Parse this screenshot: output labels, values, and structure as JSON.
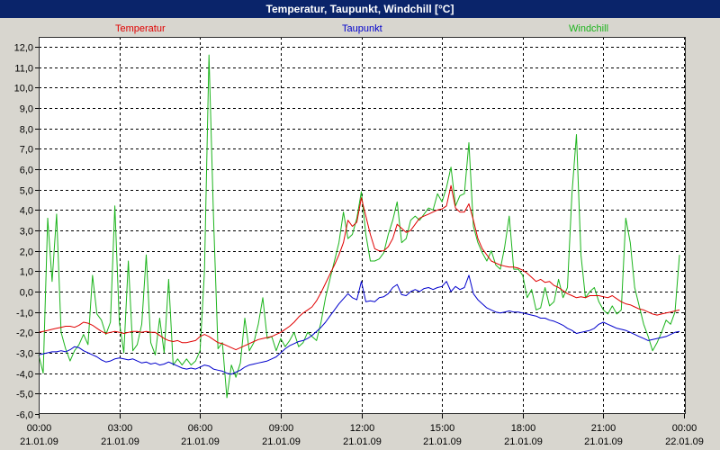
{
  "chart_data": {
    "type": "line",
    "title": "Temperatur, Taupunkt, Windchill [°C]",
    "x_axis": {
      "xlim": [
        "21.01.09 00:00",
        "22.01.09 00:00"
      ],
      "ticks": [
        {
          "time": "00:00",
          "date": "21.01.09"
        },
        {
          "time": "03:00",
          "date": "21.01.09"
        },
        {
          "time": "06:00",
          "date": "21.01.09"
        },
        {
          "time": "09:00",
          "date": "21.01.09"
        },
        {
          "time": "12:00",
          "date": "21.01.09"
        },
        {
          "time": "15:00",
          "date": "21.01.09"
        },
        {
          "time": "18:00",
          "date": "21.01.09"
        },
        {
          "time": "21:00",
          "date": "21.01.09"
        },
        {
          "time": "00:00",
          "date": "22.01.09"
        }
      ]
    },
    "y_axis": {
      "ylim": [
        -6,
        12
      ],
      "ticks": [
        "12,0",
        "11,0",
        "10,0",
        "9,0",
        "8,0",
        "7,0",
        "6,0",
        "5,0",
        "4,0",
        "3,0",
        "2,0",
        "1,0",
        "0,0",
        "-1,0",
        "-2,0",
        "-3,0",
        "-4,0",
        "-5,0",
        "-6,0"
      ]
    },
    "grid": true,
    "legend": "top",
    "x": [
      "00:00",
      "00:10",
      "00:20",
      "00:30",
      "00:40",
      "00:50",
      "01:00",
      "01:10",
      "01:20",
      "01:30",
      "01:40",
      "01:50",
      "02:00",
      "02:10",
      "02:20",
      "02:30",
      "02:40",
      "02:50",
      "03:00",
      "03:10",
      "03:20",
      "03:30",
      "03:40",
      "03:50",
      "04:00",
      "04:10",
      "04:20",
      "04:30",
      "04:40",
      "04:50",
      "05:00",
      "05:10",
      "05:20",
      "05:30",
      "05:40",
      "05:50",
      "06:00",
      "06:10",
      "06:20",
      "06:30",
      "06:40",
      "06:50",
      "07:00",
      "07:10",
      "07:20",
      "07:30",
      "07:40",
      "07:50",
      "08:00",
      "08:10",
      "08:20",
      "08:30",
      "08:40",
      "08:50",
      "09:00",
      "09:10",
      "09:20",
      "09:30",
      "09:40",
      "09:50",
      "10:00",
      "10:10",
      "10:20",
      "10:30",
      "10:40",
      "10:50",
      "11:00",
      "11:10",
      "11:20",
      "11:30",
      "11:40",
      "11:50",
      "12:00",
      "12:10",
      "12:20",
      "12:30",
      "12:40",
      "12:50",
      "13:00",
      "13:10",
      "13:20",
      "13:30",
      "13:40",
      "13:50",
      "14:00",
      "14:10",
      "14:20",
      "14:30",
      "14:40",
      "14:50",
      "15:00",
      "15:10",
      "15:20",
      "15:30",
      "15:40",
      "15:50",
      "16:00",
      "16:10",
      "16:20",
      "16:30",
      "16:40",
      "16:50",
      "17:00",
      "17:10",
      "17:20",
      "17:30",
      "17:40",
      "17:50",
      "18:00",
      "18:10",
      "18:20",
      "18:30",
      "18:40",
      "18:50",
      "19:00",
      "19:10",
      "19:20",
      "19:30",
      "19:40",
      "19:50",
      "20:00",
      "20:10",
      "20:20",
      "20:30",
      "20:40",
      "20:50",
      "21:00",
      "21:10",
      "21:20",
      "21:30",
      "21:40",
      "21:50",
      "22:00",
      "22:10",
      "22:20",
      "22:30",
      "22:40",
      "22:50",
      "23:00",
      "23:10",
      "23:20",
      "23:30",
      "23:40",
      "23:50"
    ],
    "series": [
      {
        "name": "Temperatur",
        "color": "#e00000",
        "values": [
          -2.0,
          -1.95,
          -1.9,
          -1.85,
          -1.8,
          -1.75,
          -1.7,
          -1.7,
          -1.75,
          -1.65,
          -1.5,
          -1.55,
          -1.65,
          -1.8,
          -1.95,
          -2.05,
          -2.0,
          -1.95,
          -2.0,
          -2.05,
          -2.0,
          -1.95,
          -1.95,
          -2.0,
          -1.95,
          -2.0,
          -2.0,
          -2.15,
          -2.3,
          -2.4,
          -2.45,
          -2.4,
          -2.5,
          -2.5,
          -2.45,
          -2.4,
          -2.2,
          -2.1,
          -2.2,
          -2.35,
          -2.5,
          -2.55,
          -2.65,
          -2.75,
          -2.85,
          -2.75,
          -2.65,
          -2.55,
          -2.45,
          -2.35,
          -2.3,
          -2.25,
          -2.2,
          -2.1,
          -2.0,
          -1.85,
          -1.7,
          -1.5,
          -1.25,
          -1.05,
          -0.9,
          -0.75,
          -0.45,
          -0.05,
          0.4,
          0.85,
          1.3,
          1.8,
          2.4,
          3.5,
          3.2,
          3.4,
          4.6,
          3.7,
          2.8,
          2.1,
          2.0,
          2.0,
          2.2,
          2.6,
          3.3,
          3.1,
          2.9,
          3.0,
          3.3,
          3.6,
          3.7,
          3.8,
          3.9,
          4.0,
          4.05,
          4.2,
          5.2,
          4.1,
          3.9,
          3.9,
          4.3,
          3.5,
          2.6,
          2.1,
          1.8,
          1.5,
          1.4,
          1.3,
          1.25,
          1.2,
          1.2,
          1.15,
          1.05,
          0.9,
          0.7,
          0.5,
          0.6,
          0.45,
          0.5,
          0.3,
          0.2,
          0.05,
          -0.1,
          -0.2,
          -0.3,
          -0.25,
          -0.3,
          -0.2,
          -0.2,
          -0.2,
          -0.25,
          -0.3,
          -0.2,
          -0.35,
          -0.5,
          -0.6,
          -0.65,
          -0.75,
          -0.85,
          -0.9,
          -1.0,
          -1.1,
          -1.15,
          -1.1,
          -1.05,
          -1.0,
          -0.95,
          -0.9
        ]
      },
      {
        "name": "Taupunkt",
        "color": "#0000cc",
        "values": [
          -3.1,
          -3.05,
          -3.0,
          -2.95,
          -2.95,
          -2.9,
          -2.95,
          -2.85,
          -2.7,
          -2.75,
          -2.9,
          -3.0,
          -3.1,
          -3.2,
          -3.35,
          -3.45,
          -3.4,
          -3.3,
          -3.25,
          -3.3,
          -3.35,
          -3.3,
          -3.4,
          -3.5,
          -3.45,
          -3.55,
          -3.5,
          -3.6,
          -3.55,
          -3.45,
          -3.55,
          -3.65,
          -3.75,
          -3.8,
          -3.75,
          -3.8,
          -3.7,
          -3.6,
          -3.65,
          -3.8,
          -3.85,
          -3.9,
          -4.0,
          -4.05,
          -3.95,
          -3.85,
          -3.7,
          -3.6,
          -3.55,
          -3.5,
          -3.45,
          -3.4,
          -3.3,
          -3.2,
          -3.0,
          -2.8,
          -2.65,
          -2.55,
          -2.45,
          -2.4,
          -2.3,
          -2.15,
          -1.95,
          -1.75,
          -1.5,
          -1.2,
          -0.9,
          -0.6,
          -0.35,
          -0.1,
          -0.3,
          -0.4,
          0.5,
          -0.5,
          -0.45,
          -0.5,
          -0.3,
          -0.25,
          -0.1,
          0.2,
          0.35,
          -0.15,
          -0.2,
          0.0,
          0.1,
          0.0,
          0.15,
          0.2,
          0.1,
          0.2,
          0.25,
          0.5,
          0.0,
          0.25,
          0.1,
          0.2,
          0.8,
          -0.1,
          -0.4,
          -0.6,
          -0.8,
          -0.9,
          -1.0,
          -1.05,
          -1.0,
          -0.95,
          -1.0,
          -1.0,
          -1.05,
          -1.1,
          -1.15,
          -1.2,
          -1.3,
          -1.3,
          -1.4,
          -1.45,
          -1.55,
          -1.65,
          -1.8,
          -1.9,
          -2.05,
          -2.0,
          -1.95,
          -1.9,
          -1.8,
          -1.6,
          -1.5,
          -1.6,
          -1.7,
          -1.8,
          -1.85,
          -1.9,
          -2.0,
          -2.1,
          -2.2,
          -2.3,
          -2.4,
          -2.35,
          -2.3,
          -2.25,
          -2.2,
          -2.1,
          -2.0,
          -1.95
        ]
      },
      {
        "name": "Windchill",
        "color": "#1cb41c",
        "values": [
          -3.1,
          -4.0,
          3.6,
          0.5,
          3.8,
          -2.0,
          -2.8,
          -3.4,
          -2.9,
          -2.6,
          -2.1,
          -2.6,
          0.8,
          -1.1,
          -1.4,
          -2.1,
          -1.5,
          4.2,
          -1.5,
          -3.0,
          1.5,
          -2.9,
          -2.6,
          -1.6,
          1.8,
          -2.5,
          -3.1,
          -1.3,
          -3.0,
          0.6,
          -3.6,
          -3.3,
          -3.6,
          -3.3,
          -3.6,
          -3.4,
          -2.9,
          1.0,
          11.6,
          3.7,
          -2.8,
          -2.5,
          -5.2,
          -3.6,
          -4.2,
          -3.5,
          -1.3,
          -2.9,
          -2.5,
          -1.6,
          -0.3,
          -2.3,
          -2.2,
          -2.9,
          -2.3,
          -2.7,
          -2.4,
          -2.0,
          -2.7,
          -2.5,
          -2.0,
          -2.2,
          -2.4,
          -1.5,
          -0.3,
          0.6,
          1.5,
          2.4,
          3.9,
          2.6,
          2.8,
          3.6,
          4.9,
          2.8,
          1.5,
          1.5,
          1.6,
          1.9,
          2.8,
          3.5,
          4.4,
          2.4,
          2.6,
          3.5,
          3.7,
          3.5,
          3.8,
          4.1,
          4.0,
          4.8,
          4.4,
          5.1,
          6.1,
          4.2,
          4.7,
          4.8,
          7.3,
          3.2,
          2.4,
          1.9,
          1.5,
          2.0,
          1.3,
          1.1,
          2.2,
          3.7,
          1.1,
          1.1,
          0.8,
          -0.3,
          0.1,
          -0.9,
          -0.8,
          0.2,
          -0.7,
          -0.5,
          0.6,
          -0.3,
          0.2,
          4.8,
          7.7,
          1.8,
          -0.3,
          0.0,
          0.2,
          -0.5,
          -0.9,
          -1.1,
          -0.7,
          -1.1,
          -0.9,
          3.6,
          2.4,
          0.2,
          -0.7,
          -1.6,
          -2.2,
          -2.9,
          -2.5,
          -2.0,
          -1.4,
          -1.6,
          -1.0,
          1.8
        ]
      }
    ]
  }
}
